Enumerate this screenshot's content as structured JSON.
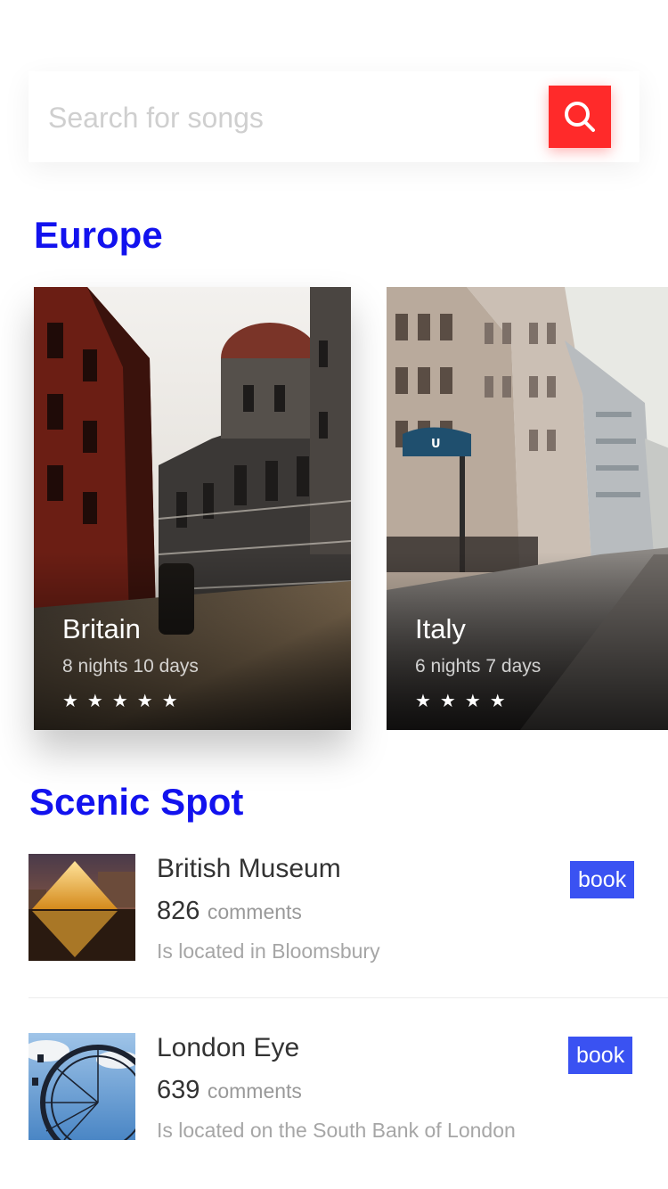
{
  "search": {
    "placeholder": "Search for songs"
  },
  "sections": {
    "europe_title": "Europe",
    "scenic_title": "Scenic Spot"
  },
  "destinations": [
    {
      "name": "Britain",
      "duration": "8 nights 10 days",
      "rating": 5,
      "stars": "★★★★★"
    },
    {
      "name": "Italy",
      "duration": "6 nights 7 days",
      "rating": 4,
      "stars": "★★★★"
    }
  ],
  "spots": [
    {
      "name": "British Museum",
      "comments_count": "826",
      "comments_label": "comments",
      "location": "Is located in Bloomsbury",
      "book_label": "book"
    },
    {
      "name": "London Eye",
      "comments_count": "639",
      "comments_label": "comments",
      "location": "Is located on the South Bank of London",
      "book_label": "book"
    }
  ],
  "colors": {
    "accent_red": "#ff2a2a",
    "title_blue": "#1212ee",
    "book_blue": "#3a52f2"
  },
  "icons": {
    "search": "search-icon"
  }
}
